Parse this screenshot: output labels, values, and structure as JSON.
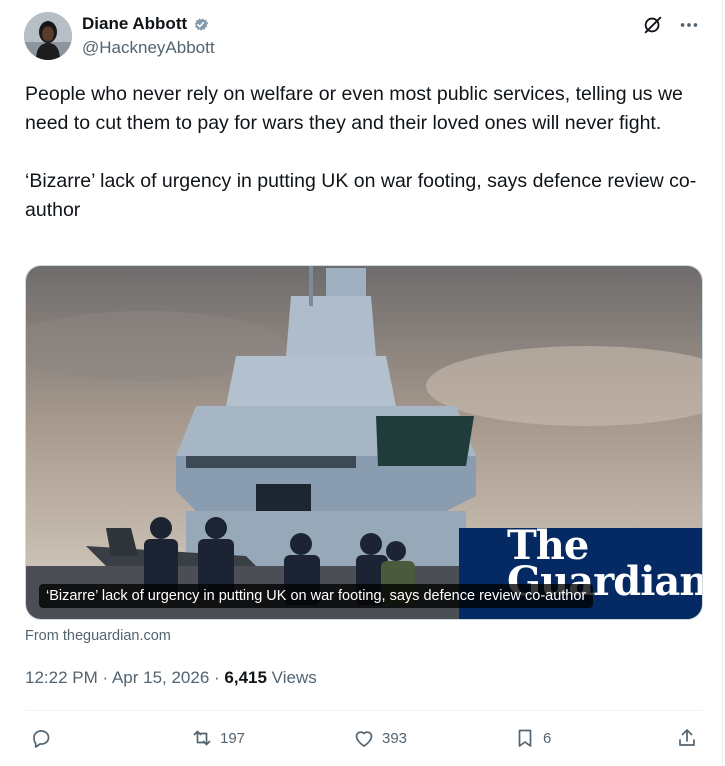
{
  "author": {
    "display_name": "Diane Abbott",
    "handle": "@HackneyAbbott"
  },
  "tweet": {
    "text": "People who never rely on welfare or even most public services, telling us we need to cut them to pay for wars they and their loved ones will never fight.\n\n‘Bizarre’ lack of urgency in putting UK on war footing, says defence review co-author"
  },
  "card": {
    "caption": "‘Bizarre’ lack of urgency in putting UK on war footing, says defence review co-author",
    "logo_line1": "The",
    "logo_line2": "Guardian",
    "source": "From theguardian.com"
  },
  "meta": {
    "time": "12:22 PM",
    "sep1": " · ",
    "date": "Apr 15, 2026",
    "sep2": " · ",
    "views_count": "6,415",
    "views_label": " Views"
  },
  "actions": {
    "replies": "",
    "reposts": "197",
    "likes": "393",
    "bookmarks": "6"
  },
  "colors": {
    "text": "#0f1419",
    "muted": "#536471",
    "verified": "#829aab",
    "guardian": "#052962"
  },
  "icons": [
    "verified-badge-icon",
    "grok-icon",
    "more-icon",
    "reply-icon",
    "repost-icon",
    "like-icon",
    "bookmark-icon",
    "share-icon"
  ]
}
